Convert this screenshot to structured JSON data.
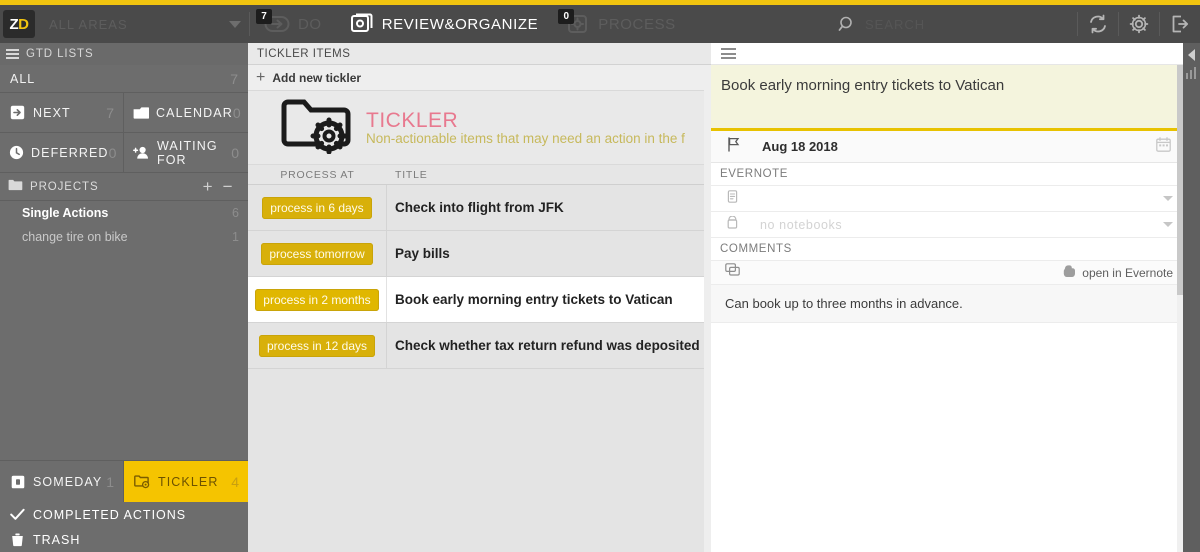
{
  "topbar": {
    "logo_z": "Z",
    "logo_d": "D",
    "area_label": "ALL AREAS",
    "nav": [
      {
        "label": "DO",
        "badge": "7",
        "active": false,
        "icon": "arrow-in-box-icon"
      },
      {
        "label": "REVIEW&ORGANIZE",
        "badge": "",
        "active": true,
        "icon": "copy-stack-icon"
      },
      {
        "label": "PROCESS",
        "badge": "0",
        "active": false,
        "icon": "gear-box-icon"
      }
    ],
    "search_placeholder": "SEARCH",
    "search_value": "",
    "refresh_label": "refresh-icon",
    "settings_label": "gear-icon",
    "logout_label": "logout-icon"
  },
  "sidebar": {
    "gtd_header": "GTD LISTS",
    "gtd_header_count": "",
    "all": {
      "label": "ALL",
      "count": "7"
    },
    "cells": [
      {
        "label": "NEXT",
        "count": "7",
        "icon": "next-arrow-icon"
      },
      {
        "label": "CALENDAR",
        "count": "0",
        "icon": "calendar-icon"
      },
      {
        "label": "DEFERRED",
        "count": "0",
        "icon": "clock-icon"
      },
      {
        "label": "WAITING FOR",
        "count": "0",
        "icon": "person-add-icon"
      }
    ],
    "projects_header": "PROJECTS",
    "projects_add": "+",
    "projects_collapse": "−",
    "projects": [
      {
        "name": "Single Actions",
        "count": "6",
        "bold": true
      },
      {
        "name": "change tire on bike",
        "count": "1",
        "bold": false
      }
    ],
    "someday": {
      "label": "SOMEDAY",
      "count": "1",
      "icon": "box-icon"
    },
    "tickler": {
      "label": "TICKLER",
      "count": "4",
      "icon": "folder-gear-icon"
    },
    "completed": {
      "label": "COMPLETED ACTIONS",
      "icon": "check-icon"
    },
    "trash": {
      "label": "TRASH",
      "icon": "trash-icon"
    }
  },
  "center": {
    "header": "TICKLER ITEMS",
    "add_label": "Add new tickler",
    "banner_title": "TICKLER",
    "banner_subtitle": "Non-actionable items that may need an action in the f",
    "columns": {
      "process_at": "PROCESS AT",
      "title": "TITLE"
    },
    "rows": [
      {
        "chip": "process in 6 days",
        "title": "Check into flight from JFK",
        "selected": false
      },
      {
        "chip": "process tomorrow",
        "title": "Pay bills",
        "selected": false
      },
      {
        "chip": "process in 2 months",
        "title": "Book early morning entry tickets to Vatican",
        "selected": true
      },
      {
        "chip": "process in 12 days",
        "title": "Check whether tax return refund was deposited",
        "selected": false
      }
    ]
  },
  "detail": {
    "title_value": "Book early morning entry tickets to Vatican",
    "date_value": "Aug 18 2018",
    "evernote_header": "EVERNOTE",
    "evernote_fields": [
      {
        "value": "",
        "icon": "note-icon"
      },
      {
        "value": "no notebooks",
        "icon": "notebook-icon"
      }
    ],
    "comments_header": "COMMENTS",
    "open_in_evernote": "open in Evernote",
    "comment_text": "Can book up to three months in advance."
  },
  "colors": {
    "accent_yellow": "#f5c400",
    "chip_gold": "#d8b00a",
    "banner_pink": "#e8798f",
    "banner_olive": "#c7b95c",
    "topbar_dark": "#4a4a4a",
    "sidebar_gray": "#6d6d6d"
  }
}
